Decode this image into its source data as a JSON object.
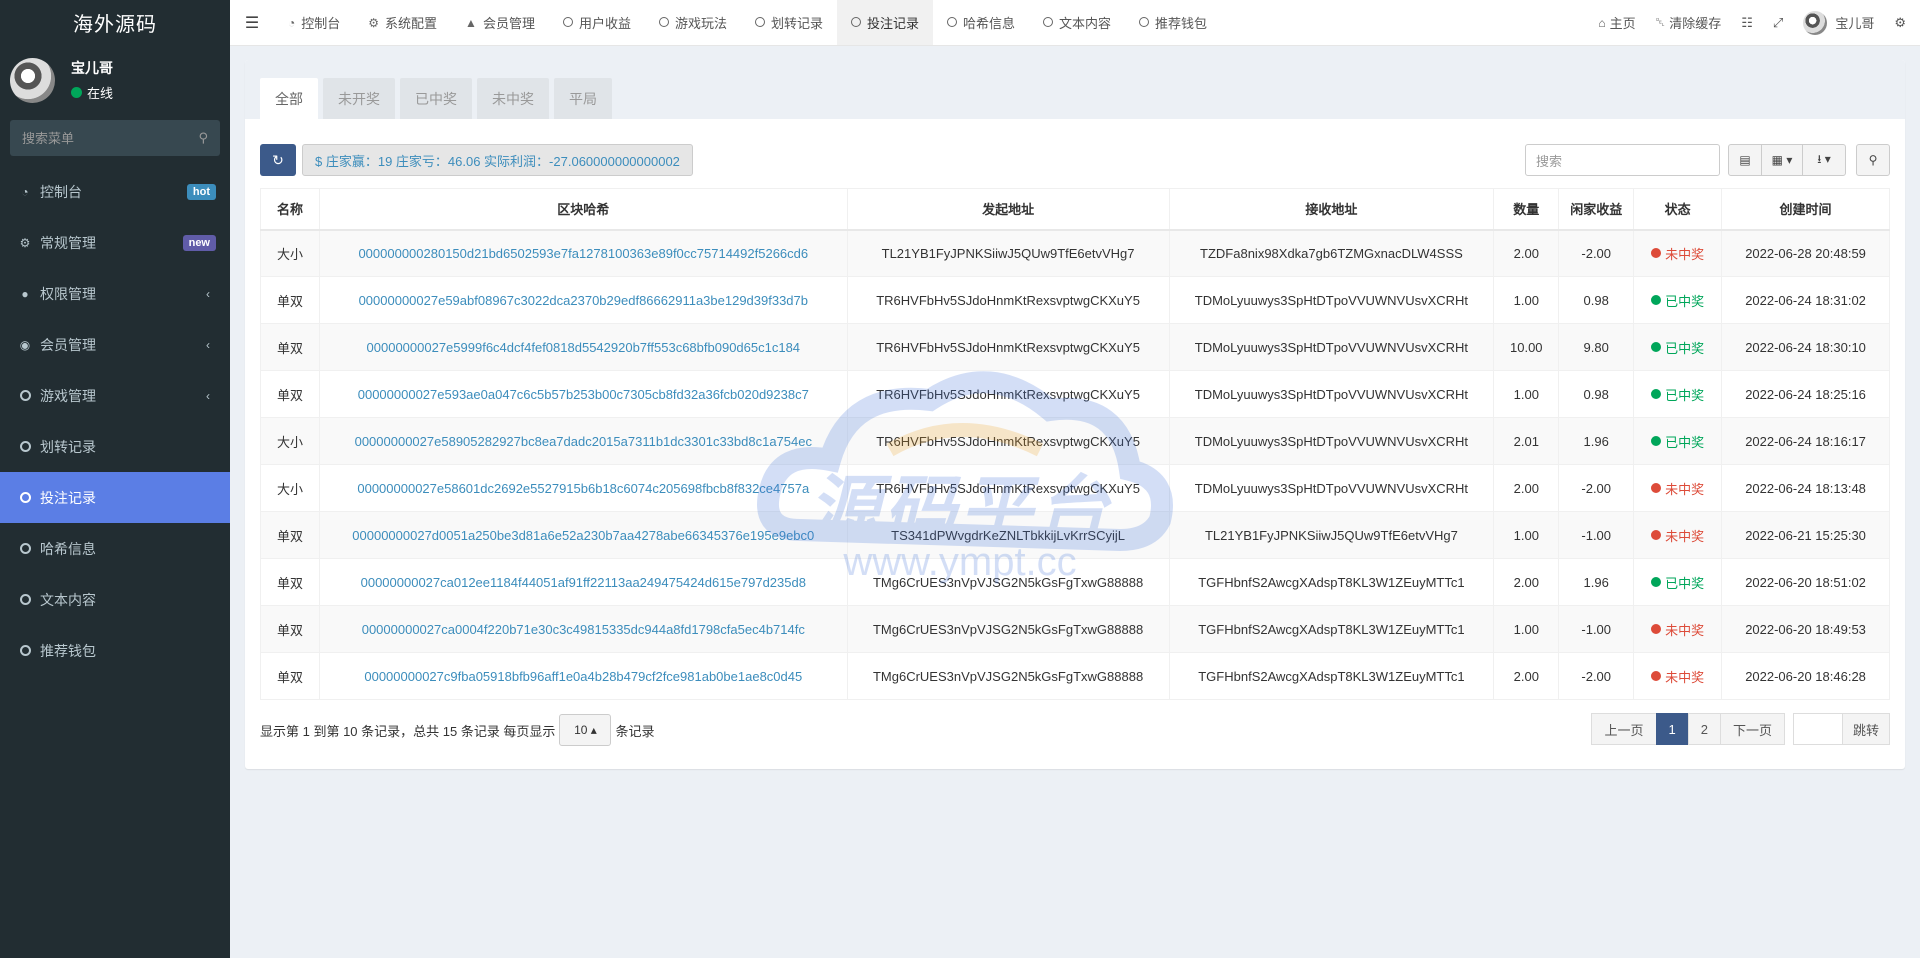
{
  "sidebar": {
    "logo": "海外源码",
    "user": {
      "name": "宝儿哥",
      "status": "在线"
    },
    "search_placeholder": "搜索菜单",
    "items": [
      {
        "label": "控制台",
        "icon": "dashboard-icon",
        "badge": "hot"
      },
      {
        "label": "常规管理",
        "icon": "cogs-icon",
        "badge": "new"
      },
      {
        "label": "权限管理",
        "icon": "group-icon",
        "chevron": true
      },
      {
        "label": "会员管理",
        "icon": "user-circle-icon",
        "chevron": true
      },
      {
        "label": "游戏管理",
        "icon": "circle-icon",
        "chevron": true
      },
      {
        "label": "划转记录",
        "icon": "circle-icon"
      },
      {
        "label": "投注记录",
        "icon": "circle-icon",
        "active": true
      },
      {
        "label": "哈希信息",
        "icon": "circle-icon"
      },
      {
        "label": "文本内容",
        "icon": "circle-icon"
      },
      {
        "label": "推荐钱包",
        "icon": "circle-icon"
      }
    ]
  },
  "topbar": {
    "tabs": [
      {
        "label": "控制台",
        "icon": "dashboard-icon"
      },
      {
        "label": "系统配置",
        "icon": "gear-icon"
      },
      {
        "label": "会员管理",
        "icon": "user-icon"
      },
      {
        "label": "用户收益",
        "icon": "circle-icon"
      },
      {
        "label": "游戏玩法",
        "icon": "circle-icon"
      },
      {
        "label": "划转记录",
        "icon": "circle-icon"
      },
      {
        "label": "投注记录",
        "icon": "circle-icon",
        "active": true
      },
      {
        "label": "哈希信息",
        "icon": "circle-icon"
      },
      {
        "label": "文本内容",
        "icon": "circle-icon"
      },
      {
        "label": "推荐钱包",
        "icon": "circle-icon"
      }
    ],
    "home": "主页",
    "clear_cache": "清除缓存",
    "user_name": "宝儿哥"
  },
  "filters": [
    "全部",
    "未开奖",
    "已中奖",
    "未中奖",
    "平局"
  ],
  "stats_text": "$ 庄家赢：19 庄家亏：46.06 实际利润：-27.060000000000002",
  "search_placeholder": "搜索",
  "table": {
    "headers": [
      "名称",
      "区块哈希",
      "发起地址",
      "接收地址",
      "数量",
      "闲家收益",
      "状态",
      "创建时间"
    ],
    "rows": [
      [
        "大小",
        "000000000280150d21bd6502593e7fa1278100363e89f0cc75714492f5266cd6",
        "TL21YB1FyJPNKSiiwJ5QUw9TfE6etvVHg7",
        "TZDFa8nix98Xdka7gb6TZMGxnacDLW4SSS",
        "2.00",
        "-2.00",
        "未中奖",
        "2022-06-28 20:48:59"
      ],
      [
        "单双",
        "00000000027e59abf08967c3022dca2370b29edf86662911a3be129d39f33d7b",
        "TR6HVFbHv5SJdoHnmKtRexsvptwgCKXuY5",
        "TDMoLyuuwys3SpHtDTpoVVUWNVUsvXCRHt",
        "1.00",
        "0.98",
        "已中奖",
        "2022-06-24 18:31:02"
      ],
      [
        "单双",
        "00000000027e5999f6c4dcf4fef0818d5542920b7ff553c68bfb090d65c1c184",
        "TR6HVFbHv5SJdoHnmKtRexsvptwgCKXuY5",
        "TDMoLyuuwys3SpHtDTpoVVUWNVUsvXCRHt",
        "10.00",
        "9.80",
        "已中奖",
        "2022-06-24 18:30:10"
      ],
      [
        "单双",
        "00000000027e593ae0a047c6c5b57b253b00c7305cb8fd32a36fcb020d9238c7",
        "TR6HVFbHv5SJdoHnmKtRexsvptwgCKXuY5",
        "TDMoLyuuwys3SpHtDTpoVVUWNVUsvXCRHt",
        "1.00",
        "0.98",
        "已中奖",
        "2022-06-24 18:25:16"
      ],
      [
        "大小",
        "00000000027e58905282927bc8ea7dadc2015a7311b1dc3301c33bd8c1a754ec",
        "TR6HVFbHv5SJdoHnmKtRexsvptwgCKXuY5",
        "TDMoLyuuwys3SpHtDTpoVVUWNVUsvXCRHt",
        "2.01",
        "1.96",
        "已中奖",
        "2022-06-24 18:16:17"
      ],
      [
        "大小",
        "00000000027e58601dc2692e5527915b6b18c6074c205698fbcb8f832ce4757a",
        "TR6HVFbHv5SJdoHnmKtRexsvptwgCKXuY5",
        "TDMoLyuuwys3SpHtDTpoVVUWNVUsvXCRHt",
        "2.00",
        "-2.00",
        "未中奖",
        "2022-06-24 18:13:48"
      ],
      [
        "单双",
        "00000000027d0051a250be3d81a6e52a230b7aa4278abe66345376e195e9ebc0",
        "TS341dPWvgdrKeZNLTbkkijLvKrrSCyijL",
        "TL21YB1FyJPNKSiiwJ5QUw9TfE6etvVHg7",
        "1.00",
        "-1.00",
        "未中奖",
        "2022-06-21 15:25:30"
      ],
      [
        "单双",
        "00000000027ca012ee1184f44051af91ff22113aa249475424d615e797d235d8",
        "TMg6CrUES3nVpVJSG2N5kGsFgTxwG88888",
        "TGFHbnfS2AwcgXAdspT8KL3W1ZEuyMTTc1",
        "2.00",
        "1.96",
        "已中奖",
        "2022-06-20 18:51:02"
      ],
      [
        "单双",
        "00000000027ca0004f220b71e30c3c49815335dc944a8fd1798cfa5ec4b714fc",
        "TMg6CrUES3nVpVJSG2N5kGsFgTxwG88888",
        "TGFHbnfS2AwcgXAdspT8KL3W1ZEuyMTTc1",
        "1.00",
        "-1.00",
        "未中奖",
        "2022-06-20 18:49:53"
      ],
      [
        "单双",
        "00000000027c9fba05918bfb96aff1e0a4b28b479cf2fce981ab0be1ae8c0d45",
        "TMg6CrUES3nVpVJSG2N5kGsFgTxwG88888",
        "TGFHbnfS2AwcgXAdspT8KL3W1ZEuyMTTc1",
        "2.00",
        "-2.00",
        "未中奖",
        "2022-06-20 18:46:28"
      ]
    ]
  },
  "pagination": {
    "info_prefix": "显示第 1 到第 10 条记录，总共 15 条记录 每页显示",
    "page_size": "10",
    "info_suffix": "条记录",
    "prev": "上一页",
    "pages": [
      "1",
      "2"
    ],
    "next": "下一页",
    "go": "跳转"
  },
  "watermark": {
    "text": "源码平台",
    "url": "www.ympt.cc"
  },
  "colors": {
    "sidebar_bg": "#222d32",
    "active": "#5b7ee5",
    "primary": "#3c5a8a",
    "link": "#3c8dbc",
    "won": "#00a65a",
    "lost": "#dd4b39"
  }
}
